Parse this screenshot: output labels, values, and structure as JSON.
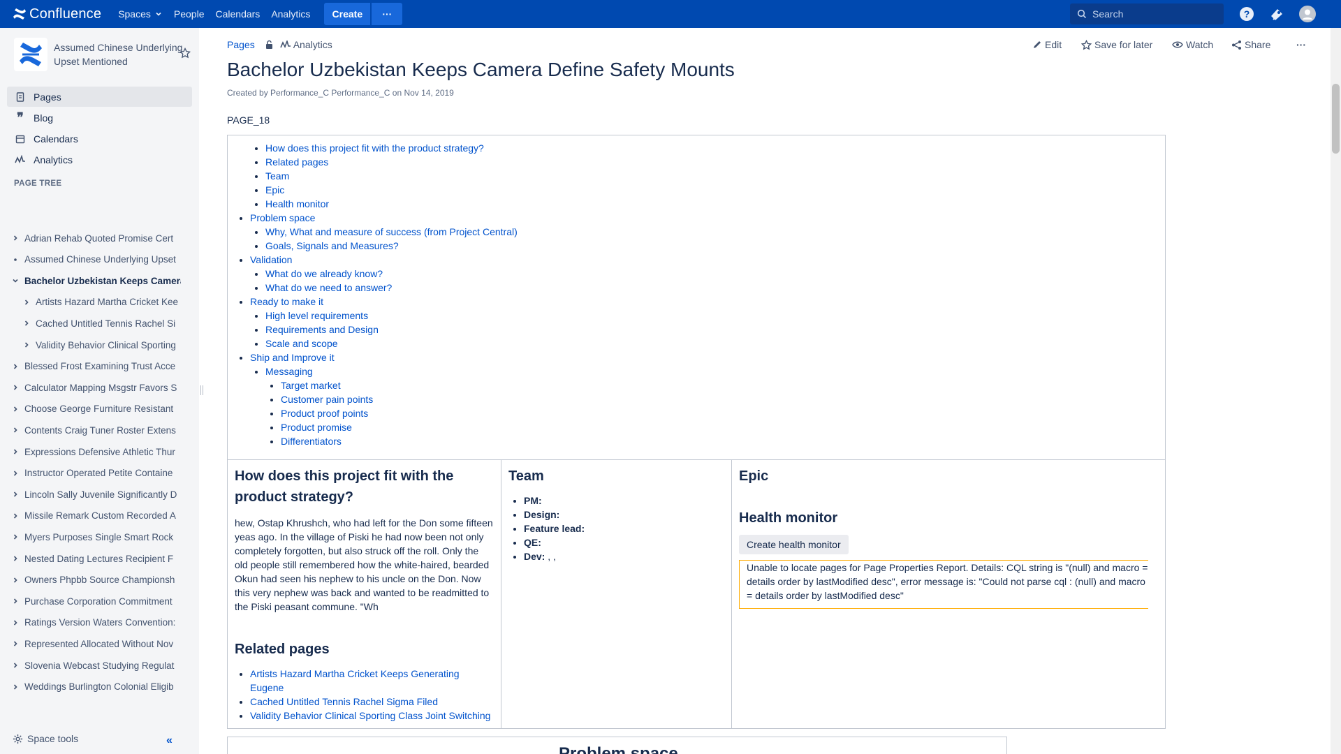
{
  "topnav": {
    "product": "Confluence",
    "items": [
      "Spaces",
      "People",
      "Calendars",
      "Analytics"
    ],
    "create": "Create",
    "more": "···",
    "search_placeholder": "Search",
    "icons": [
      "help-icon",
      "notifications-icon",
      "profile-icon"
    ],
    "brand_color": "#0049b0"
  },
  "sidebar": {
    "space_name": "Assumed Chinese Underlying Upset Mentioned",
    "nav": [
      {
        "label": "Pages",
        "icon": "pages-icon",
        "active": true
      },
      {
        "label": "Blog",
        "icon": "blog-quote-icon",
        "active": false
      },
      {
        "label": "Calendars",
        "icon": "calendar-icon",
        "active": false
      },
      {
        "label": "Analytics",
        "icon": "analytics-icon",
        "active": false
      }
    ],
    "tree_heading": "PAGE TREE",
    "tree": [
      {
        "label": "Adrian Rehab Quoted Promise Cert",
        "level": 0,
        "twisty": "chevron-right"
      },
      {
        "label": "Assumed Chinese Underlying Upset",
        "level": 0,
        "twisty": "bullet"
      },
      {
        "label": "Bachelor Uzbekistan Keeps Camera",
        "level": 0,
        "twisty": "chevron-down"
      },
      {
        "label": "Artists Hazard Martha Cricket Kee",
        "level": 1,
        "twisty": "chevron-right"
      },
      {
        "label": "Cached Untitled Tennis Rachel Si",
        "level": 1,
        "twisty": "chevron-right"
      },
      {
        "label": "Validity Behavior Clinical Sporting",
        "level": 1,
        "twisty": "chevron-right"
      },
      {
        "label": "Blessed Frost Examining Trust Acce",
        "level": 0,
        "twisty": "chevron-right"
      },
      {
        "label": "Calculator Mapping Msgstr Favors S",
        "level": 0,
        "twisty": "chevron-right"
      },
      {
        "label": "Choose George Furniture Resistant",
        "level": 0,
        "twisty": "chevron-right"
      },
      {
        "label": "Contents Craig Tuner Roster Extens",
        "level": 0,
        "twisty": "chevron-right"
      },
      {
        "label": "Expressions Defensive Athletic Thur",
        "level": 0,
        "twisty": "chevron-right"
      },
      {
        "label": "Instructor Operated Petite Containe",
        "level": 0,
        "twisty": "chevron-right"
      },
      {
        "label": "Lincoln Sally Juvenile Significantly D",
        "level": 0,
        "twisty": "chevron-right"
      },
      {
        "label": "Missile Remark Custom Recorded A",
        "level": 0,
        "twisty": "chevron-right"
      },
      {
        "label": "Myers Purposes Single Smart Rock",
        "level": 0,
        "twisty": "chevron-right"
      },
      {
        "label": "Nested Dating Lectures Recipient F",
        "level": 0,
        "twisty": "chevron-right"
      },
      {
        "label": "Owners Phpbb Source Championsh",
        "level": 0,
        "twisty": "chevron-right"
      },
      {
        "label": "Purchase Corporation Commitment",
        "level": 0,
        "twisty": "chevron-right"
      },
      {
        "label": "Ratings Version Waters Convention:",
        "level": 0,
        "twisty": "chevron-right"
      },
      {
        "label": "Represented Allocated Without Nov",
        "level": 0,
        "twisty": "chevron-right"
      },
      {
        "label": "Slovenia Webcast Studying Regulat",
        "level": 0,
        "twisty": "chevron-right"
      },
      {
        "label": "Weddings Burlington Colonial Eligib",
        "level": 0,
        "twisty": "chevron-right"
      }
    ],
    "space_tools": "Space tools",
    "collapse": "«"
  },
  "page": {
    "breadcrumb_pages": "Pages",
    "breadcrumb_analytics": "Analytics",
    "actions": {
      "edit": "Edit",
      "save": "Save for later",
      "watch": "Watch",
      "share": "Share",
      "more": "···"
    },
    "title": "Bachelor Uzbekistan Keeps Camera Define Safety Mounts",
    "byline": "Created by Performance_C Performance_C on Nov 14, 2019",
    "page_id": "PAGE_18",
    "toc": {
      "intro": [
        "How does this project fit with the product strategy?",
        "Related pages",
        "Team",
        "Epic",
        "Health monitor"
      ],
      "problem": "Problem space",
      "problem_children": [
        "Why, What and measure of success (from Project Central)",
        "Goals, Signals and Measures?"
      ],
      "validation": "Validation",
      "validation_children": [
        "What do we already know?",
        "What do we need to answer?"
      ],
      "ready": "Ready to make it",
      "ready_children": [
        "High level requirements",
        "Requirements and Design",
        "Scale and scope"
      ],
      "ship": "Ship and Improve it",
      "messaging": "Messaging",
      "messaging_children": [
        "Target market",
        "Customer pain points",
        "Product proof points",
        "Product promise",
        "Differentiators"
      ]
    },
    "strategy": {
      "heading": "How does this project fit with the product strategy?",
      "body": "hew, Ostap Khrushch, who had left for the Don some fifteen yeas ago. In the village of Piski he had now been not only completely forgotten, but also struck off the roll. Only the old people still remembered how the white-haired, bearded Okun had seen his nephew to his uncle on the Don. Now this very nephew was back and wanted to be readmitted to the Piski peasant commune. \"Wh"
    },
    "related": {
      "heading": "Related pages",
      "links": [
        "Artists Hazard Martha Cricket Keeps Generating Eugene",
        "Cached Untitled Tennis Rachel Sigma Filed",
        "Validity Behavior Clinical Sporting Class Joint Switching"
      ]
    },
    "team": {
      "heading": "Team",
      "roles": [
        {
          "label": "PM:",
          "value": ""
        },
        {
          "label": "Design:",
          "value": ""
        },
        {
          "label": "Feature lead:",
          "value": ""
        },
        {
          "label": "QE:",
          "value": ""
        },
        {
          "label": "Dev:",
          "value": " , ,"
        }
      ]
    },
    "epic": {
      "heading": "Epic"
    },
    "health": {
      "heading": "Health monitor",
      "button": "Create health monitor",
      "error": "Unable to locate pages for Page Properties Report. Details: CQL string is \"(null) and macro = details order by lastModified desc\", error message is: \"Could not parse cql : (null) and macro = details order by lastModified desc\""
    },
    "problem_space_heading": "Problem space"
  }
}
